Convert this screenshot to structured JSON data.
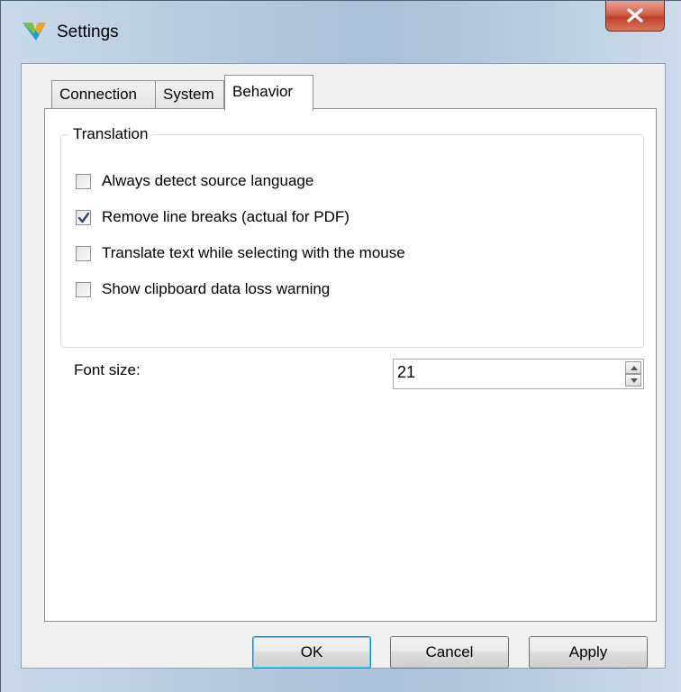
{
  "window": {
    "title": "Settings"
  },
  "tabs": [
    {
      "label": "Connection",
      "active": false
    },
    {
      "label": "System",
      "active": false
    },
    {
      "label": "Behavior",
      "active": true
    }
  ],
  "translation_group": {
    "label": "Translation",
    "options": [
      {
        "label": "Always detect source language",
        "checked": false
      },
      {
        "label": "Remove line breaks (actual for PDF)",
        "checked": true
      },
      {
        "label": "Translate text while selecting with the mouse",
        "checked": false
      },
      {
        "label": "Show clipboard data loss warning",
        "checked": false
      }
    ]
  },
  "font_size": {
    "label": "Font size:",
    "value": "21"
  },
  "buttons": {
    "ok": "OK",
    "cancel": "Cancel",
    "apply": "Apply"
  },
  "icons": {
    "app": "app-logo-icon",
    "close": "close-icon",
    "check": "checkmark-icon",
    "spin_up": "spin-up-icon",
    "spin_down": "spin-down-icon"
  },
  "colors": {
    "close_button": "#c7462e",
    "check_mark": "#23447a",
    "default_button_border": "#3c7fb1",
    "panel_background": "#f0f0f0"
  }
}
